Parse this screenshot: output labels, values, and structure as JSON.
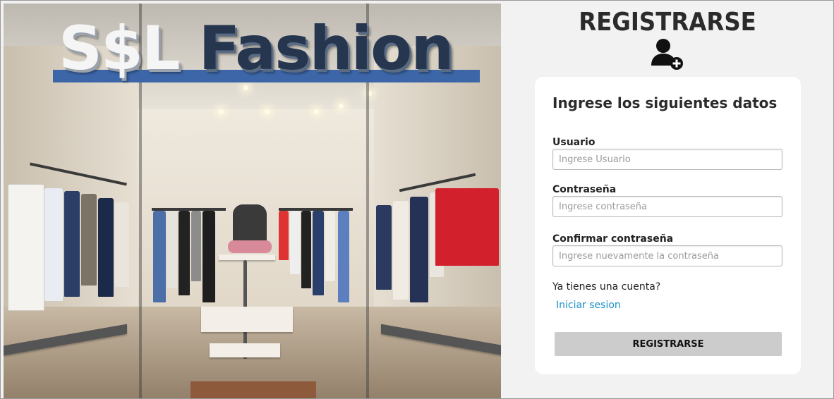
{
  "hero": {
    "sign_part1": "S$L",
    "sign_part2": "Fashion"
  },
  "page": {
    "title": "REGISTRARSE",
    "icon": "user-plus-icon"
  },
  "form": {
    "heading": "Ingrese los siguientes datos",
    "username_label": "Usuario",
    "username_placeholder": "Ingrese Usuario",
    "password_label": "Contraseña",
    "password_placeholder": "Ingrese contraseña",
    "confirm_label": "Confirmar contraseña",
    "confirm_placeholder": "Ingrese nuevamente la contraseña",
    "account_prompt": "Ya tienes una cuenta?",
    "login_link": "Iniciar sesion",
    "submit_label": "REGISTRARSE"
  },
  "colors": {
    "panel_bg": "#f2f2f2",
    "card_bg": "#ffffff",
    "link": "#1e90c8",
    "button_bg": "#cccccc",
    "sign_band": "#3c66a8"
  }
}
